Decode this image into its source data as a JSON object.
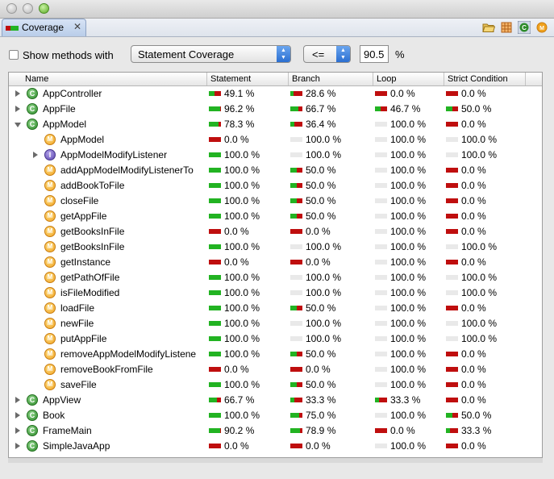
{
  "view": {
    "tab_label": "Coverage",
    "close_glyph": "✕",
    "toolbar_icons": [
      "open-folder-icon",
      "grid-icon",
      "class-filter-icon",
      "method-filter-icon"
    ]
  },
  "filter": {
    "checkbox_label": "Show methods with",
    "metric_selected": "Statement Coverage",
    "operator_selected": "<=",
    "threshold_value": "90.5",
    "unit": "%"
  },
  "table": {
    "columns": [
      "Name",
      "Statement",
      "Branch",
      "Loop",
      "Strict Condition"
    ],
    "rows": [
      {
        "name": "AppController",
        "level": 0,
        "icon": "class",
        "exp": "right",
        "stmt": 49.1,
        "branch": 28.6,
        "loop": 0.0,
        "strict": 0.0
      },
      {
        "name": "AppFile",
        "level": 0,
        "icon": "class",
        "exp": "right",
        "stmt": 96.2,
        "branch": 66.7,
        "loop": 46.7,
        "strict": 50.0
      },
      {
        "name": "AppModel",
        "level": 0,
        "icon": "class",
        "exp": "down",
        "stmt": 78.3,
        "branch": 36.4,
        "loop": 100.0,
        "strict": 0.0
      },
      {
        "name": "AppModel",
        "level": 1,
        "icon": "method",
        "exp": "",
        "stmt": 0.0,
        "branch": 100.0,
        "loop": 100.0,
        "strict": 100.0
      },
      {
        "name": "AppModelModifyListener",
        "level": 1,
        "icon": "interface",
        "exp": "right",
        "stmt": 100.0,
        "branch": 100.0,
        "loop": 100.0,
        "strict": 100.0
      },
      {
        "name": "addAppModelModifyListenerTo",
        "level": 1,
        "icon": "method",
        "exp": "",
        "stmt": 100.0,
        "branch": 50.0,
        "loop": 100.0,
        "strict": 0.0
      },
      {
        "name": "addBookToFile",
        "level": 1,
        "icon": "method",
        "exp": "",
        "stmt": 100.0,
        "branch": 50.0,
        "loop": 100.0,
        "strict": 0.0
      },
      {
        "name": "closeFile",
        "level": 1,
        "icon": "method",
        "exp": "",
        "stmt": 100.0,
        "branch": 50.0,
        "loop": 100.0,
        "strict": 0.0
      },
      {
        "name": "getAppFile",
        "level": 1,
        "icon": "method",
        "exp": "",
        "stmt": 100.0,
        "branch": 50.0,
        "loop": 100.0,
        "strict": 0.0
      },
      {
        "name": "getBooksInFile",
        "level": 1,
        "icon": "method",
        "exp": "",
        "stmt": 0.0,
        "branch": 0.0,
        "loop": 100.0,
        "strict": 0.0
      },
      {
        "name": "getBooksInFile",
        "level": 1,
        "icon": "method",
        "exp": "",
        "stmt": 100.0,
        "branch": 100.0,
        "loop": 100.0,
        "strict": 100.0
      },
      {
        "name": "getInstance",
        "level": 1,
        "icon": "method",
        "exp": "",
        "stmt": 0.0,
        "branch": 0.0,
        "loop": 100.0,
        "strict": 0.0
      },
      {
        "name": "getPathOfFile",
        "level": 1,
        "icon": "method",
        "exp": "",
        "stmt": 100.0,
        "branch": 100.0,
        "loop": 100.0,
        "strict": 100.0
      },
      {
        "name": "isFileModified",
        "level": 1,
        "icon": "method",
        "exp": "",
        "stmt": 100.0,
        "branch": 100.0,
        "loop": 100.0,
        "strict": 100.0
      },
      {
        "name": "loadFile",
        "level": 1,
        "icon": "method",
        "exp": "",
        "stmt": 100.0,
        "branch": 50.0,
        "loop": 100.0,
        "strict": 0.0
      },
      {
        "name": "newFile",
        "level": 1,
        "icon": "method",
        "exp": "",
        "stmt": 100.0,
        "branch": 100.0,
        "loop": 100.0,
        "strict": 100.0
      },
      {
        "name": "putAppFile",
        "level": 1,
        "icon": "method",
        "exp": "",
        "stmt": 100.0,
        "branch": 100.0,
        "loop": 100.0,
        "strict": 100.0
      },
      {
        "name": "removeAppModelModifyListene",
        "level": 1,
        "icon": "method",
        "exp": "",
        "stmt": 100.0,
        "branch": 50.0,
        "loop": 100.0,
        "strict": 0.0
      },
      {
        "name": "removeBookFromFile",
        "level": 1,
        "icon": "method",
        "exp": "",
        "stmt": 0.0,
        "branch": 0.0,
        "loop": 100.0,
        "strict": 0.0
      },
      {
        "name": "saveFile",
        "level": 1,
        "icon": "method",
        "exp": "",
        "stmt": 100.0,
        "branch": 50.0,
        "loop": 100.0,
        "strict": 0.0
      },
      {
        "name": "AppView",
        "level": 0,
        "icon": "class",
        "exp": "right",
        "stmt": 66.7,
        "branch": 33.3,
        "loop": 33.3,
        "strict": 0.0
      },
      {
        "name": "Book",
        "level": 0,
        "icon": "class",
        "exp": "right",
        "stmt": 100.0,
        "branch": 75.0,
        "loop": 100.0,
        "strict": 50.0
      },
      {
        "name": "FrameMain",
        "level": 0,
        "icon": "class",
        "exp": "right",
        "stmt": 90.2,
        "branch": 78.9,
        "loop": 0.0,
        "strict": 33.3
      },
      {
        "name": "SimpleJavaApp",
        "level": 0,
        "icon": "class",
        "exp": "right",
        "stmt": 0.0,
        "branch": 0.0,
        "loop": 100.0,
        "strict": 0.0
      }
    ]
  },
  "colors": {
    "covered": "#22b322",
    "uncovered": "#bf0e0e",
    "na": "#e9e9e9"
  }
}
